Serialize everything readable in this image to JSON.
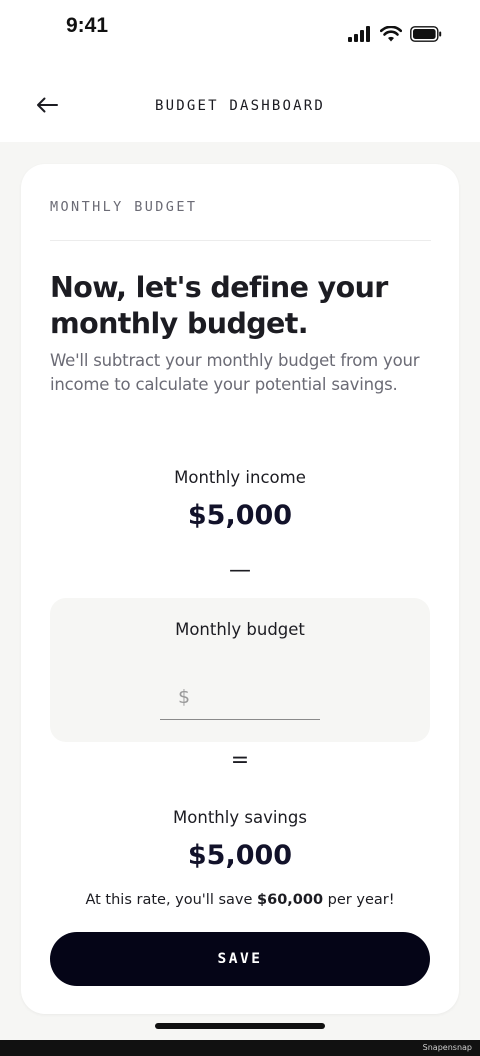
{
  "status_bar": {
    "time": "9:41",
    "icons": [
      "signal-icon",
      "wifi-icon",
      "battery-icon"
    ]
  },
  "nav": {
    "back_icon": "arrow-left-icon",
    "title": "BUDGET DASHBOARD"
  },
  "card": {
    "header": "MONTHLY BUDGET",
    "headline": "Now, let's define your monthly budget.",
    "subtext": "We'll subtract your monthly budget from your income to calculate your potential savings.",
    "income_label": "Monthly income",
    "income_value": "$5,000",
    "minus_symbol": "—",
    "budget_label": "Monthly budget",
    "currency_symbol": "$",
    "budget_input_value": "",
    "equals_symbol": "=",
    "savings_label": "Monthly savings",
    "savings_value": "$5,000",
    "rate_prefix": "At this rate, you'll save ",
    "rate_amount": "$60,000",
    "rate_suffix": " per year!",
    "save_label": "SAVE"
  },
  "watermark": "Snapensnap",
  "colors": {
    "background": "#f6f6f4",
    "card": "#ffffff",
    "primary_button": "#050517",
    "muted_text": "#6b6b75"
  }
}
